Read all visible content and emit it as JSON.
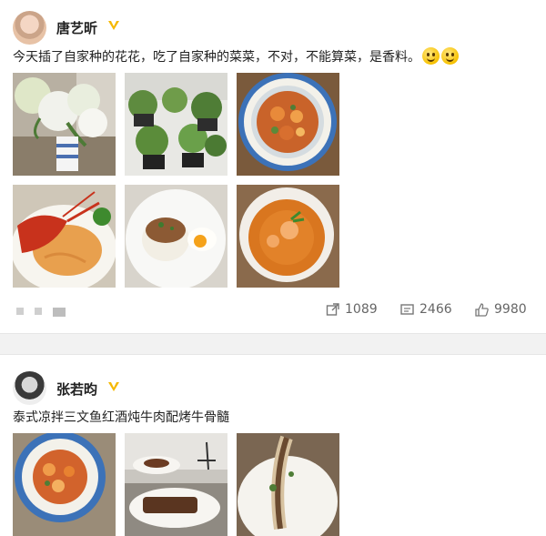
{
  "posts": [
    {
      "username": "唐艺昕",
      "text": "今天插了自家种的花花，吃了自家种的菜菜，不对，不能算菜，是香料。",
      "emojis": [
        "smile-emoji",
        "smile-emoji"
      ],
      "photos": [
        "white-hydrangeas-vase",
        "potted-herbs",
        "shrimp-dish-blue-plate",
        "lobster-noodles",
        "basil-rice-fried-egg",
        "tom-yum-soup"
      ],
      "stats": {
        "repost": "1089",
        "comment": "2466",
        "like": "9980"
      }
    },
    {
      "username": "张若昀",
      "text": "泰式凉拌三文鱼红酒炖牛肉配烤牛骨髓",
      "photos": [
        "salmon-salad-blue-plate",
        "braised-beef-table",
        "roasted-bone-marrow"
      ]
    }
  ],
  "colors": {
    "verified": "#f5b800",
    "accent_gray": "#666666",
    "divider": "#f2f2f2"
  }
}
